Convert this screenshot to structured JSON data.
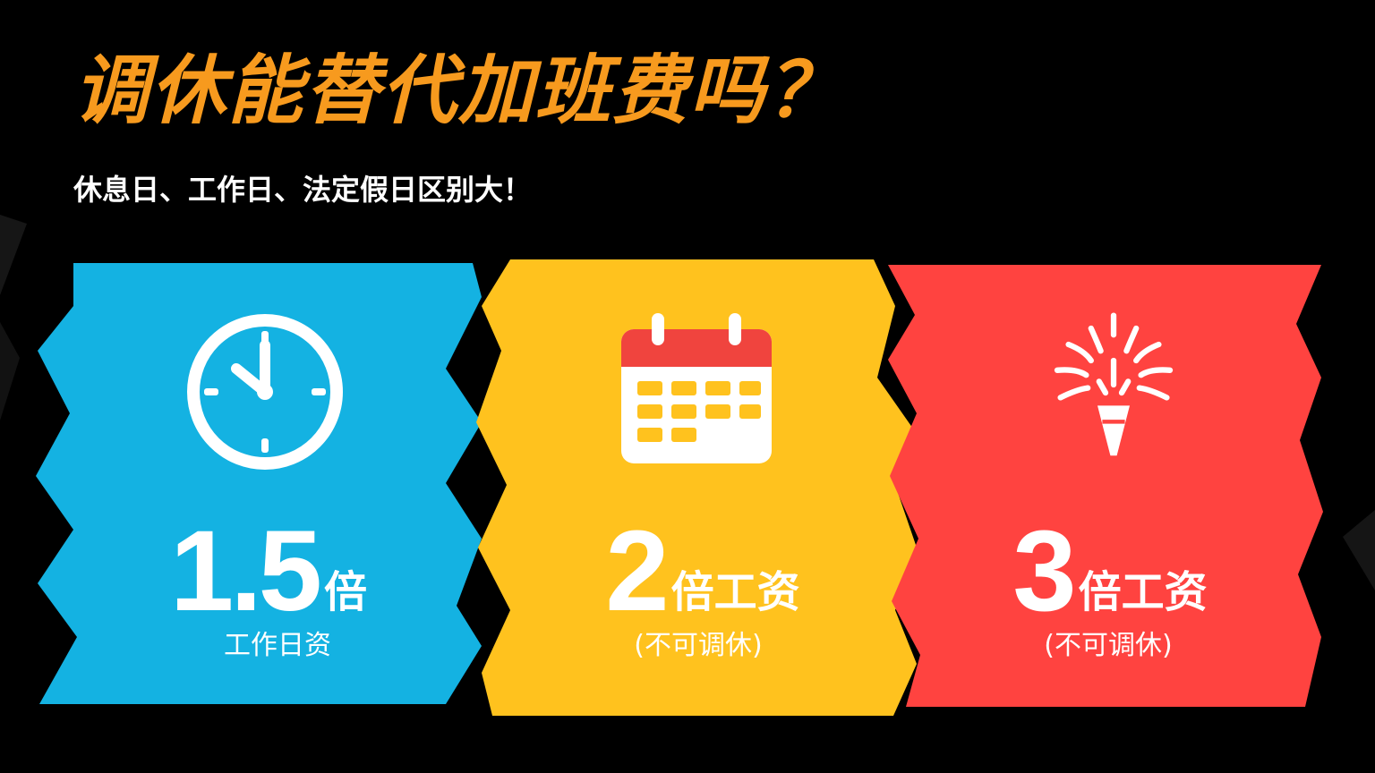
{
  "header": {
    "title": "调休能替代加班费吗？",
    "subtitle": "休息日、工作日、法定假日区别大！"
  },
  "colors": {
    "background": "#000000",
    "title": "#F79A1E",
    "card_blue": "#14B2E2",
    "card_yellow": "#FFC21E",
    "card_red": "#FF4340",
    "calendar_header": "#F0443E"
  },
  "cards": [
    {
      "icon": "clock-icon",
      "number": "1.5",
      "unit": "倍",
      "note": "工作日资"
    },
    {
      "icon": "calendar-icon",
      "number": "2",
      "unit": "倍工资",
      "note": "(不可调休)"
    },
    {
      "icon": "firework-icon",
      "number": "3",
      "unit": "倍工资",
      "note": "(不可调休)"
    }
  ]
}
